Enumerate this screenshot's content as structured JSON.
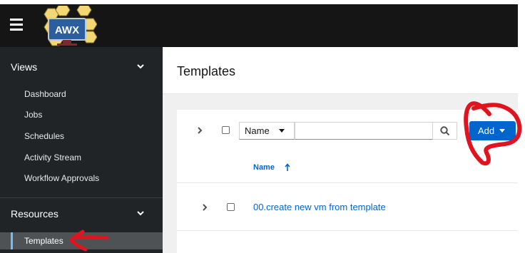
{
  "header": {
    "menu_icon": "hamburger-menu-icon",
    "logo_text": "AWX"
  },
  "sidebar": {
    "views_label": "Views",
    "views_items": [
      {
        "label": "Dashboard"
      },
      {
        "label": "Jobs"
      },
      {
        "label": "Schedules"
      },
      {
        "label": "Activity Stream"
      },
      {
        "label": "Workflow Approvals"
      }
    ],
    "resources_label": "Resources",
    "resources_items": [
      {
        "label": "Templates",
        "active": true
      }
    ]
  },
  "main": {
    "title": "Templates",
    "toolbar": {
      "filter_select_value": "Name",
      "search_value": "",
      "add_label": "Add"
    },
    "table": {
      "column_name": "Name",
      "sort": "ascending",
      "rows": [
        {
          "name": "00.create new vm from template"
        }
      ]
    }
  },
  "colors": {
    "header_bg": "#151515",
    "sidebar_bg": "#212427",
    "accent_blue": "#0066cc",
    "annotation_red": "#e0141e"
  }
}
